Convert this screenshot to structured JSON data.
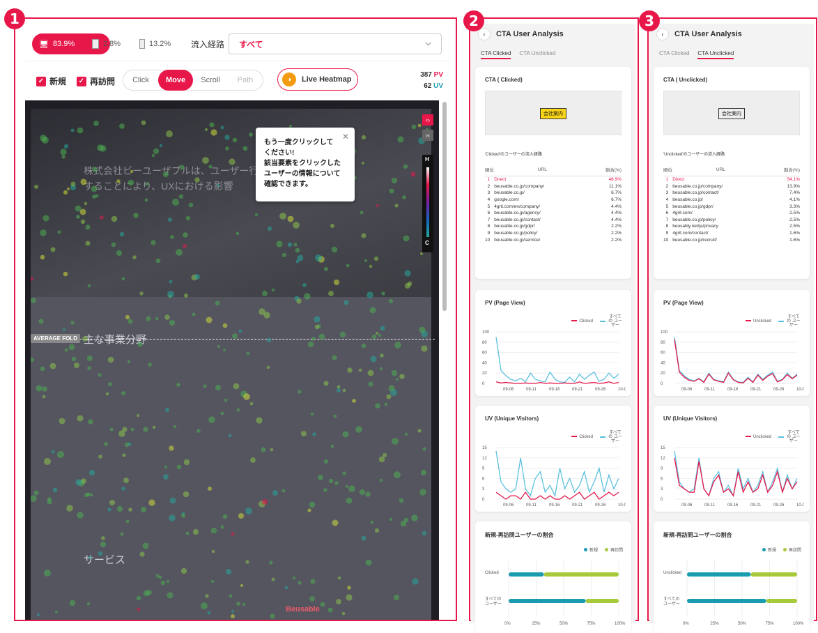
{
  "badges": [
    "1",
    "2",
    "3"
  ],
  "toolbar": {
    "devices": [
      {
        "label": "83.9%",
        "icon": "desktop-icon",
        "active": true
      },
      {
        "label": "2.8%",
        "icon": "tablet-icon",
        "active": false
      },
      {
        "label": "13.2%",
        "icon": "mobile-icon",
        "active": false
      }
    ],
    "source_label": "流入経路",
    "source_value": "すべて",
    "new_label": "新規",
    "returning_label": "再訪問",
    "modes": [
      "Click",
      "Move",
      "Scroll",
      "Path"
    ],
    "active_mode": "Move",
    "live_heatmap_label": "Live Heatmap",
    "pv": "387",
    "pv_unit": "PV",
    "uv": "62",
    "uv_unit": "UV"
  },
  "heatmap": {
    "average_fold_label": "AVERAGE FOLD",
    "section_title": "主な事業分野",
    "service_title": "サービス",
    "hero_text": "株式会社ビーユーザブルは、ユーザー行動を計測することにより、UXにおける影響",
    "brand_text": "Beusable",
    "legend_high": "H",
    "legend_low": "C",
    "tooltip": [
      "もう一度クリックして",
      "ください!",
      "該当要素をクリックした",
      "ユーザーの情報について",
      "確認できます。"
    ]
  },
  "panels": [
    {
      "title": "CTA User Analysis",
      "tabs": [
        "CTA Clicked",
        "CTA Unclicked"
      ],
      "active_tab": 0,
      "cta_card_title": "CTA ( Clicked)",
      "cta_button_label": "会社案内",
      "source_title": "'Clicked'のユーザーの流入経路",
      "table_headers": [
        "順位",
        "URL",
        "割合(%)"
      ],
      "rows": [
        [
          "1",
          "Direct",
          "48.9%"
        ],
        [
          "2",
          "beusable.co.jp/company/",
          "11.1%"
        ],
        [
          "3",
          "beusable.co.jp/",
          "6.7%"
        ],
        [
          "4",
          "google.com/",
          "6.7%"
        ],
        [
          "5",
          "4grit.com/en/company/",
          "4.4%"
        ],
        [
          "6",
          "beusable.co.jp/agency/",
          "4.4%"
        ],
        [
          "7",
          "beusable.co.jp/contact/",
          "4.4%"
        ],
        [
          "8",
          "beusable.co.jp/gdpr/",
          "2.2%"
        ],
        [
          "9",
          "beusable.co.jp/policy/",
          "2.2%"
        ],
        [
          "10",
          "beusable.co.jp/service/",
          "2.2%"
        ]
      ],
      "pv_title": "PV (Page View)",
      "uv_title": "UV (Unique Visitors)",
      "series_label": "Clicked",
      "all_users_label": "すべての ユーザー",
      "ratio_title": "新規-再訪問ユーザーの割合",
      "ratio_legend": [
        "新規",
        "再訪問"
      ],
      "ratio_rows": [
        "Clicked",
        "すべての ユーザー"
      ]
    },
    {
      "title": "CTA User Analysis",
      "tabs": [
        "CTA Clicked",
        "CTA Unclicked"
      ],
      "active_tab": 1,
      "cta_card_title": "CTA ( Unclicked)",
      "cta_button_label": "会社案内",
      "source_title": "'Unclicked'のユーザーの流入経路",
      "table_headers": [
        "順位",
        "URL",
        "割合(%)"
      ],
      "rows": [
        [
          "1",
          "Direct",
          "54.1%"
        ],
        [
          "2",
          "beusable.co.jp/company/",
          "13.9%"
        ],
        [
          "3",
          "beusable.co.jp/contact/",
          "7.4%"
        ],
        [
          "4",
          "beusable.co.jp/",
          "4.1%"
        ],
        [
          "5",
          "beusable.co.jp/gdpr/",
          "3.3%"
        ],
        [
          "6",
          "4grit.com/",
          "2.5%"
        ],
        [
          "7",
          "beusable.co.jp/policy/",
          "2.5%"
        ],
        [
          "8",
          "beusably.net/ja/privacy",
          "2.5%"
        ],
        [
          "9",
          "4grit.com/contact/",
          "1.6%"
        ],
        [
          "10",
          "beusable.co.jp/recruit/",
          "1.6%"
        ]
      ],
      "pv_title": "PV (Page View)",
      "uv_title": "UV (Unique Visitors)",
      "series_label": "Unclicked",
      "all_users_label": "すべての ユーザー",
      "ratio_title": "新規-再訪問ユーザーの割合",
      "ratio_legend": [
        "新規",
        "再訪問"
      ],
      "ratio_rows": [
        "Unclicked",
        "すべての ユーザー"
      ]
    }
  ],
  "colors": {
    "accent": "#e8174a",
    "teal": "#5bc0de",
    "new": "#1a9cb0",
    "returning": "#a8c93a"
  },
  "chart_data": [
    {
      "type": "line",
      "title": "PV (Page View)",
      "panel": "CTA Clicked",
      "x": [
        "09-06",
        "09-11",
        "09-16",
        "09-21",
        "09-26",
        "10-01"
      ],
      "ylim": [
        0,
        100
      ],
      "series": [
        {
          "name": "Clicked",
          "values": [
            3,
            1,
            2,
            1,
            0,
            0,
            1,
            0,
            0,
            2,
            0,
            1,
            0,
            0,
            1,
            0,
            0,
            3,
            0,
            1,
            2,
            0,
            1,
            3,
            0,
            2
          ]
        },
        {
          "name": "すべてのユーザー",
          "values": [
            90,
            25,
            15,
            8,
            5,
            10,
            3,
            20,
            8,
            5,
            3,
            22,
            8,
            3,
            2,
            12,
            3,
            18,
            8,
            16,
            22,
            4,
            8,
            20,
            10,
            18
          ]
        }
      ]
    },
    {
      "type": "line",
      "title": "UV (Unique Visitors)",
      "panel": "CTA Clicked",
      "x": [
        "09-06",
        "09-11",
        "09-16",
        "09-21",
        "09-26",
        "10-01"
      ],
      "ylim": [
        0,
        15
      ],
      "series": [
        {
          "name": "Clicked",
          "values": [
            2,
            1,
            0,
            1,
            1,
            0,
            2,
            0,
            0,
            1,
            0,
            1,
            0,
            0,
            1,
            0,
            1,
            2,
            0,
            1,
            2,
            0,
            1,
            2,
            1,
            2
          ]
        },
        {
          "name": "すべてのユーザー",
          "values": [
            14,
            5,
            3,
            2,
            3,
            12,
            3,
            1,
            6,
            8,
            2,
            4,
            1,
            9,
            3,
            6,
            2,
            4,
            8,
            2,
            5,
            9,
            2,
            7,
            3,
            6
          ]
        }
      ]
    },
    {
      "type": "line",
      "title": "PV (Page View)",
      "panel": "CTA Unclicked",
      "x": [
        "09-06",
        "09-11",
        "09-16",
        "09-21",
        "09-26",
        "10-01"
      ],
      "ylim": [
        0,
        100
      ],
      "series": [
        {
          "name": "Unclicked",
          "values": [
            85,
            22,
            12,
            6,
            4,
            9,
            2,
            18,
            7,
            4,
            2,
            20,
            7,
            2,
            1,
            10,
            2,
            16,
            6,
            14,
            19,
            3,
            7,
            17,
            9,
            16
          ]
        },
        {
          "name": "すべてのユーザー",
          "values": [
            90,
            25,
            15,
            8,
            5,
            10,
            3,
            20,
            8,
            5,
            3,
            22,
            8,
            3,
            2,
            12,
            3,
            18,
            8,
            16,
            22,
            4,
            8,
            20,
            10,
            18
          ]
        }
      ]
    },
    {
      "type": "line",
      "title": "UV (Unique Visitors)",
      "panel": "CTA Unclicked",
      "x": [
        "09-06",
        "09-11",
        "09-16",
        "09-21",
        "09-26",
        "10-01"
      ],
      "ylim": [
        0,
        15
      ],
      "series": [
        {
          "name": "Unclicked",
          "values": [
            12,
            4,
            3,
            2,
            2,
            11,
            3,
            1,
            5,
            7,
            2,
            3,
            1,
            8,
            2,
            5,
            2,
            3,
            7,
            2,
            4,
            8,
            2,
            6,
            3,
            5
          ]
        },
        {
          "name": "すべてのユーザー",
          "values": [
            14,
            5,
            3,
            2,
            3,
            12,
            3,
            1,
            6,
            8,
            2,
            4,
            1,
            9,
            3,
            6,
            2,
            4,
            8,
            2,
            5,
            9,
            2,
            7,
            3,
            6
          ]
        }
      ]
    },
    {
      "type": "bar",
      "title": "新規-再訪問ユーザーの割合",
      "panel": "CTA Clicked",
      "categories": [
        "Clicked",
        "すべてのユーザー"
      ],
      "series": [
        {
          "name": "新規",
          "values": [
            32,
            70
          ]
        },
        {
          "name": "再訪問",
          "values": [
            68,
            30
          ]
        }
      ],
      "xlim": [
        0,
        100
      ],
      "ticks": [
        "0%",
        "25%",
        "50%",
        "75%",
        "100%"
      ]
    },
    {
      "type": "bar",
      "title": "新規-再訪問ユーザーの割合",
      "panel": "CTA Unclicked",
      "categories": [
        "Unclicked",
        "すべてのユーザー"
      ],
      "series": [
        {
          "name": "新規",
          "values": [
            58,
            72
          ]
        },
        {
          "name": "再訪問",
          "values": [
            42,
            28
          ]
        }
      ],
      "xlim": [
        0,
        100
      ],
      "ticks": [
        "0%",
        "25%",
        "50%",
        "75%",
        "100%"
      ]
    }
  ]
}
